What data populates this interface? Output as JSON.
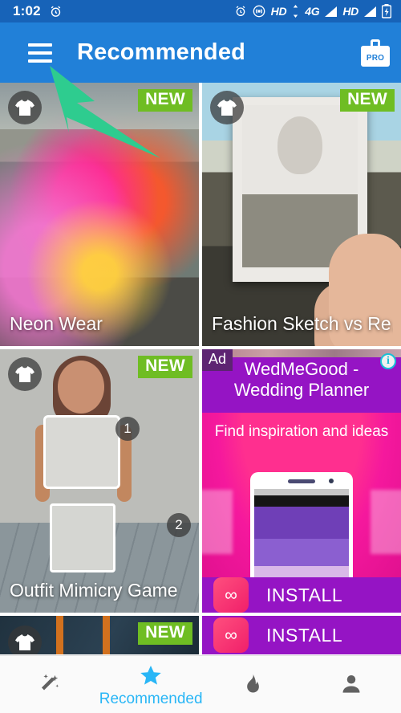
{
  "status_bar": {
    "time": "1:02",
    "alarm_icon": "alarm-clock-icon",
    "icons": [
      {
        "name": "alarm-clock-icon",
        "label": ""
      },
      {
        "name": "hotspot-icon",
        "label": ""
      },
      {
        "name": "hd-icon-1",
        "label": "HD"
      },
      {
        "name": "network-4g-icon",
        "label": "4G"
      },
      {
        "name": "signal-bars-icon-1",
        "label": ""
      },
      {
        "name": "hd-icon-2",
        "label": "HD"
      },
      {
        "name": "signal-bars-icon-2",
        "label": ""
      },
      {
        "name": "battery-charging-icon",
        "label": ""
      }
    ],
    "bg_color": "#1763b8"
  },
  "app_bar": {
    "menu_icon": "hamburger-menu-icon",
    "title": "Recommended",
    "pro_label": "PRO",
    "pro_icon": "briefcase-pro-icon",
    "bg_color": "#2180d8"
  },
  "annotation": {
    "arrow_color": "#2ecc8f",
    "points_to": "hamburger-menu-icon"
  },
  "feed": {
    "badge_new_label": "NEW",
    "badge_new_color": "#6fbd23",
    "cards": [
      {
        "title": "Neon Wear",
        "badge": "NEW",
        "category_icon": "tshirt-icon"
      },
      {
        "title": "Fashion Sketch vs Re…",
        "badge": "NEW",
        "category_icon": "tshirt-icon"
      },
      {
        "title": "Outfit Mimicry Game",
        "badge": "NEW",
        "category_icon": "tshirt-icon",
        "markers": [
          "1",
          "2"
        ]
      },
      {
        "title": "",
        "badge": "NEW",
        "category_icon": "tshirt-icon"
      }
    ]
  },
  "ad": {
    "tag": "Ad",
    "info_icon": "ad-info-icon",
    "info_glyph": "i",
    "headline": "WedMeGood - Wedding Planner",
    "subhead": "Find inspiration and ideas",
    "install_label": "INSTALL",
    "app_icon": "wedmegood-logo-icon",
    "app_icon_glyph": "∞",
    "bg_color": "#9514c4",
    "accent_color": "#f5189d"
  },
  "bottom_nav": {
    "active_color": "#29b6f6",
    "inactive_color": "#616161",
    "items": [
      {
        "icon": "magic-wand-icon",
        "label": "",
        "active": false
      },
      {
        "icon": "star-icon",
        "label": "Recommended",
        "active": true
      },
      {
        "icon": "flame-icon",
        "label": "",
        "active": false
      },
      {
        "icon": "person-icon",
        "label": "",
        "active": false
      }
    ]
  }
}
